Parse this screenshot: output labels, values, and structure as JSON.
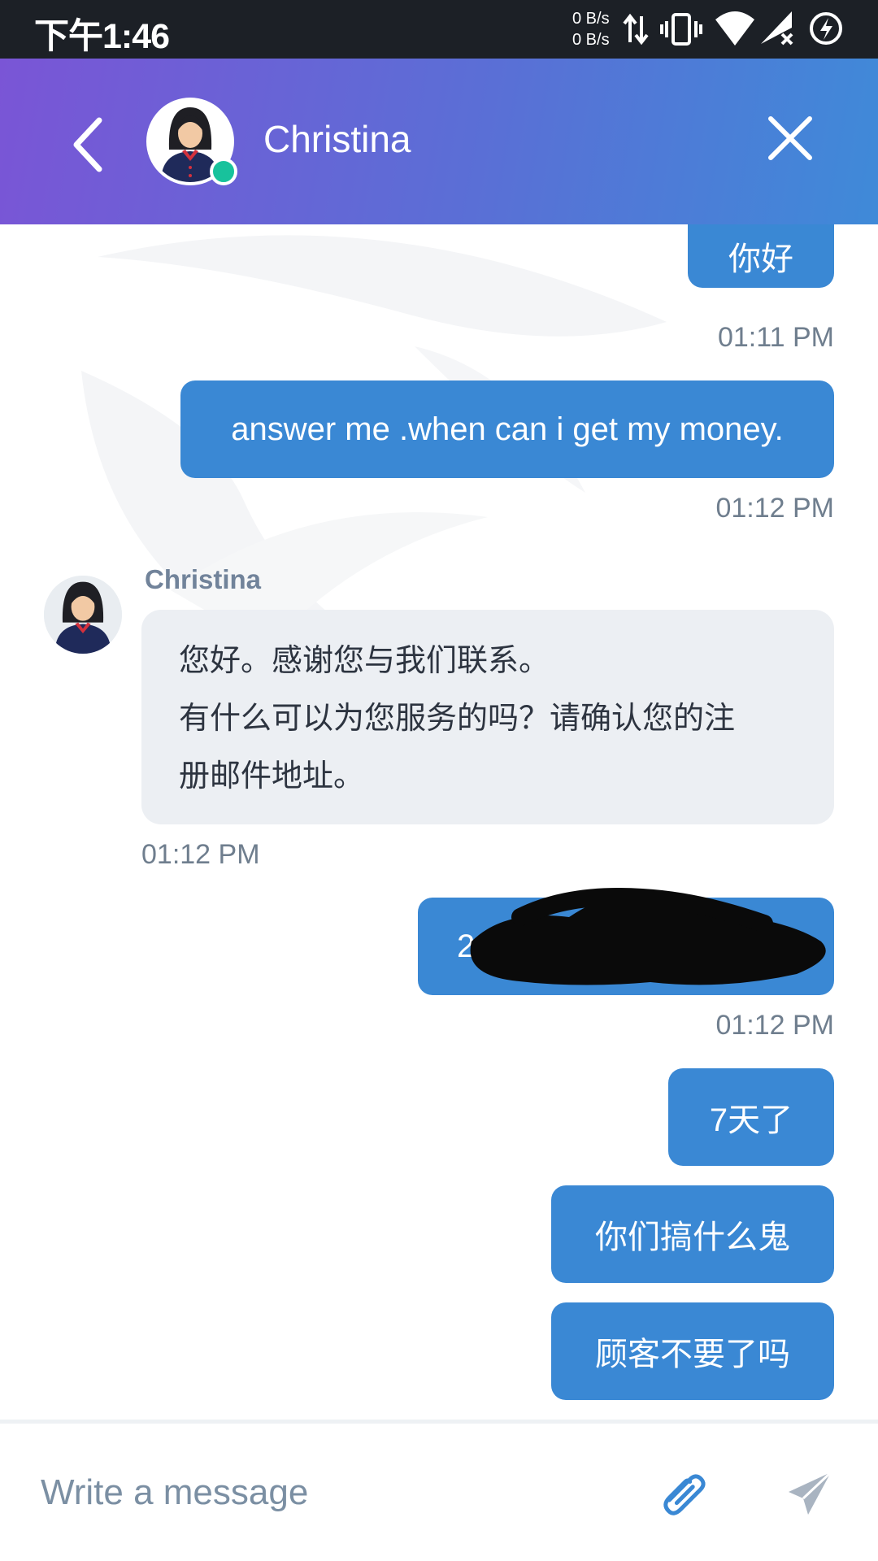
{
  "status_bar": {
    "time": "下午1:46",
    "net_up": "0 B/s",
    "net_down": "0 B/s",
    "icons": [
      "data-transfer-icon",
      "vibrate-icon",
      "wifi-icon",
      "cellular-no-signal-icon",
      "battery-saver-icon"
    ]
  },
  "header": {
    "contact_name": "Christina",
    "online": true,
    "colors": {
      "gradient_start": "#7a55d6",
      "gradient_end": "#3f8ad8",
      "online_dot": "#18c29c"
    },
    "icons": {
      "back": "chevron-left-icon",
      "close": "close-icon",
      "avatar": "agent-avatar"
    }
  },
  "messages": [
    {
      "direction": "out",
      "text": "你好",
      "time": "01:11 PM"
    },
    {
      "direction": "out",
      "text": "answer me .when can i get my money.",
      "time": "01:12 PM"
    },
    {
      "direction": "in",
      "sender": "Christina",
      "lines": [
        "您好。感谢您与我们联系。",
        "有什么可以为您服务的吗？请确认您的注",
        "册邮件地址。"
      ],
      "time": "01:12 PM"
    },
    {
      "direction": "out",
      "text": "2",
      "redacted": true,
      "time": "01:12 PM"
    },
    {
      "direction": "out",
      "text": "7天了"
    },
    {
      "direction": "out",
      "text": "你们搞什么鬼"
    },
    {
      "direction": "out",
      "text": "顾客不要了吗"
    }
  ],
  "input": {
    "placeholder": "Write a message",
    "icons": {
      "attach": "paperclip-icon",
      "send": "send-icon"
    }
  },
  "colors": {
    "outgoing_bubble": "#3a88d4",
    "incoming_bubble": "#eceff3",
    "timestamp": "#6f7e8e"
  }
}
